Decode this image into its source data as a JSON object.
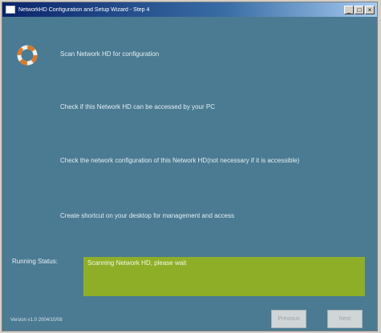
{
  "window": {
    "title": "NetworkHD Configuration and Setup Wizard - Step 4"
  },
  "steps": [
    {
      "label": "Scan Network HD for configuration"
    },
    {
      "label": "Check if this Network HD can be accessed by your PC"
    },
    {
      "label": "Check the network configuration of this Network HD(not necessary if it is accessible)"
    },
    {
      "label": "Create shortcut on your desktop for management and access"
    }
  ],
  "status": {
    "label": "Running Status:",
    "message": "Scanning Network HD, please wait"
  },
  "footer": {
    "version": "Version v1.0 2004/10/08"
  },
  "buttons": {
    "previous": "Previous",
    "next": "Next"
  },
  "colors": {
    "background": "#4a7b93",
    "status_box": "#8fae27",
    "title_bar": "#0a246a",
    "step_icon": "#d87a2a"
  },
  "icons": {
    "step_icon": "ring-progress-icon"
  }
}
